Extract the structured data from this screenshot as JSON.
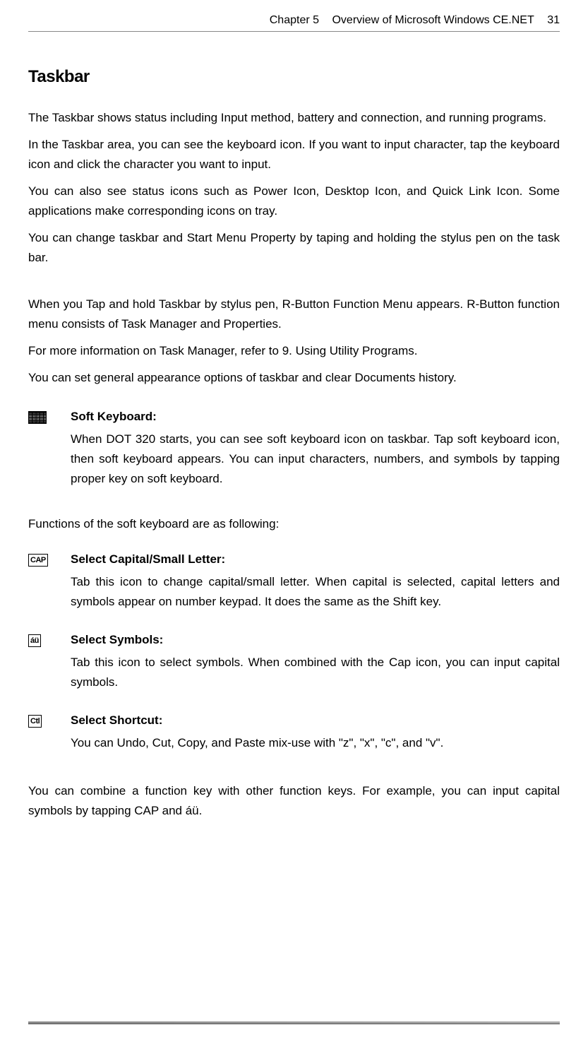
{
  "header": {
    "chapter": "Chapter 5",
    "title": "Overview of Microsoft Windows CE.NET",
    "page": "31"
  },
  "section": {
    "title": "Taskbar"
  },
  "paragraphs": {
    "p1": "The Taskbar shows status including Input method, battery and connection, and running programs.",
    "p2": "In the Taskbar area, you can see the keyboard icon. If you want to input character, tap the keyboard icon and click the character you want to input.",
    "p3": "You can also see status icons such as Power Icon, Desktop Icon, and Quick Link Icon. Some applications make corresponding icons on tray.",
    "p4": "You can change taskbar and Start Menu Property by taping and holding the stylus pen on the task bar.",
    "p5": "When you Tap and hold Taskbar by stylus pen, R-Button Function Menu appears. R-Button function menu consists of Task Manager and Properties.",
    "p6a": "For more information on Task Manager, refer to ",
    "p6b": "9. Using Utility Programs",
    "p6c": ".",
    "p7": "You can set general appearance options of taskbar and clear Documents history."
  },
  "features": {
    "soft_keyboard": {
      "icon_label": "",
      "title": "Soft Keyboard:",
      "text": "When DOT 320 starts, you can see soft keyboard icon on taskbar. Tap soft keyboard icon, then soft keyboard appears. You can input characters, numbers, and symbols by tapping proper key on soft keyboard."
    },
    "functions_intro": "Functions of the soft keyboard are as following:",
    "cap": {
      "icon_label": "CAP",
      "title": "Select Capital/Small Letter:",
      "text": "Tab this icon to change capital/small letter. When capital is selected, capital letters and symbols appear on number keypad. It does the same as the Shift key."
    },
    "symbols": {
      "icon_label": "áü",
      "title": "Select Symbols:",
      "text": "Tab this icon to select symbols. When combined with the Cap icon, you can input capital symbols."
    },
    "shortcut": {
      "icon_label": "Ctl",
      "title": "Select Shortcut:",
      "text": " You can Undo, Cut, Copy, and Paste mix-use with \"z\", \"x\", \"c\", and \"v\"."
    }
  },
  "closing": "You can combine a function key with other function keys. For example, you can input capital symbols by tapping CAP and áü."
}
